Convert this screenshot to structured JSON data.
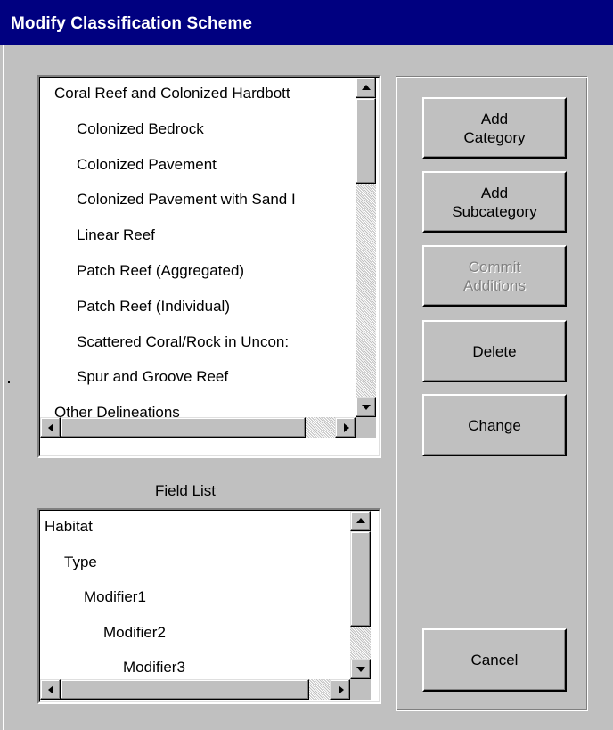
{
  "window": {
    "title": "Modify Classification Scheme"
  },
  "classification_tree": {
    "items": [
      {
        "label": "Coral Reef and Colonized Hardbott",
        "level": 0
      },
      {
        "label": "Colonized Bedrock",
        "level": 1
      },
      {
        "label": "Colonized Pavement",
        "level": 1
      },
      {
        "label": "Colonized Pavement with Sand I",
        "level": 1
      },
      {
        "label": "Linear Reef",
        "level": 1
      },
      {
        "label": "Patch Reef (Aggregated)",
        "level": 1
      },
      {
        "label": "Patch Reef (Individual)",
        "level": 1
      },
      {
        "label": "Scattered Coral/Rock in Uncon:",
        "level": 1
      },
      {
        "label": "Spur and Groove Reef",
        "level": 1
      },
      {
        "label": "Other Delineations",
        "level": 0
      }
    ]
  },
  "field_list": {
    "label": "Field List",
    "items": [
      {
        "label": "Habitat",
        "level": 0
      },
      {
        "label": "Type",
        "level": 1
      },
      {
        "label": "Modifier1",
        "level": 2
      },
      {
        "label": "Modifier2",
        "level": 3
      },
      {
        "label": "Modifier3",
        "level": 4
      }
    ]
  },
  "buttons": {
    "add_category": "Add\nCategory",
    "add_subcategory": "Add\nSubcategory",
    "commit_additions": "Commit\nAdditions",
    "delete": "Delete",
    "change": "Change",
    "cancel": "Cancel"
  },
  "icons": {
    "scroll_up": "scroll-up-arrow",
    "scroll_down": "scroll-down-arrow",
    "scroll_left": "scroll-left-arrow",
    "scroll_right": "scroll-right-arrow"
  },
  "colors": {
    "titlebar": "#000080",
    "face": "#c0c0c0",
    "disabled_text": "#808080"
  }
}
